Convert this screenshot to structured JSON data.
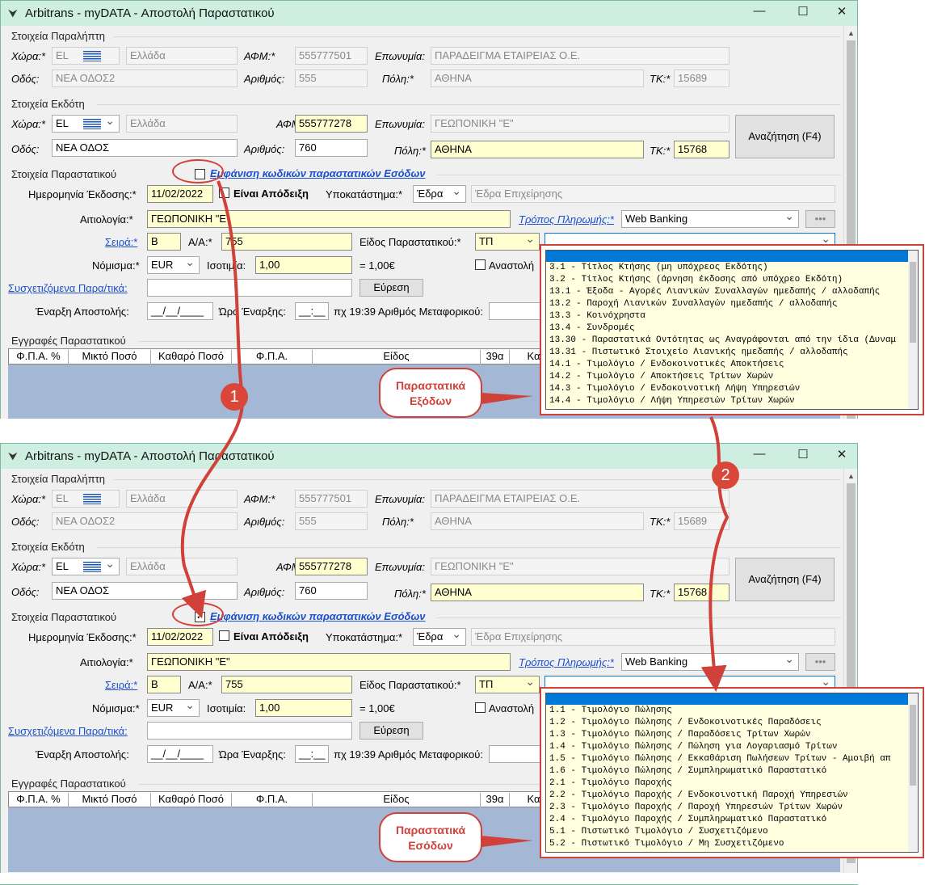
{
  "window": {
    "title": "Arbitrans - myDATA - Αποστολή Παραστατικού",
    "minimize": "—",
    "maximize": "☐",
    "close": "✕"
  },
  "recipient": {
    "section": "Στοιχεία Παραλήπτη",
    "country_label": "Χώρα:*",
    "country_code": "EL",
    "country_name": "Ελλάδα",
    "afm_label": "ΑΦΜ:*",
    "afm": "555777501",
    "name_label": "Επωνυμία:",
    "name": "ΠΑΡΑΔΕΙΓΜΑ ΕΤΑΙΡΕΙΑΣ Ο.Ε.",
    "street_label": "Οδός:",
    "street": "ΝΕΑ ΟΔΟΣ2",
    "number_label": "Αριθμός:",
    "number": "555",
    "city_label": "Πόλη:*",
    "city": "ΑΘΗΝΑ",
    "zip_label": "ΤΚ:*",
    "zip": "15689"
  },
  "issuer": {
    "section": "Στοιχεία Εκδότη",
    "country_label": "Χώρα:*",
    "country_code": "EL",
    "country_name": "Ελλάδα",
    "afm_label": "ΑΦΜ:*",
    "afm": "555777278",
    "name_label": "Επωνυμία:",
    "name": "ΓΕΩΠΟΝΙΚΗ \"Ε\"",
    "street_label": "Οδός:",
    "street": "ΝΕΑ ΟΔΟΣ",
    "number_label": "Αριθμός:",
    "number": "760",
    "city_label": "Πόλη:*",
    "city": "ΑΘΗΝΑ",
    "zip_label": "ΤΚ:*",
    "zip1": "15768",
    "zip2": "15768",
    "search_button": "Αναζήτηση (F4)"
  },
  "document": {
    "section": "Στοιχεία Παραστατικού",
    "expense_codes_link": "Εμφάνιση κωδικών παραστατικών Εσόδων",
    "check_mark": "✓",
    "date_label": "Ημερομηνία Έκδοσης:*",
    "date": "11/02/2022",
    "is_receipt": "Είναι Απόδειξη",
    "branch_label": "Υποκατάστημα:*",
    "branch": "Έδρα",
    "branch_desc": "Έδρα Επιχείρησης",
    "reason_label": "Αιτιολογία:*",
    "reason": "ΓΕΩΠΟΝΙΚΗ \"Ε\"",
    "payment_link": "Τρόπος Πληρωμής:*",
    "payment": "Web Banking",
    "more_button": "•••",
    "series_link": "Σειρά:*",
    "series": "Β",
    "aa_label": "Α/Α:*",
    "aa": "755",
    "type_label": "Είδος Παραστατικού:*",
    "type": "ΤΠ",
    "currency_label": "Νόμισμα:*",
    "currency": "EUR",
    "rate_label": "Ισοτιμία:",
    "rate": "1,00",
    "rate_eq": "= 1,00€",
    "suspend_label": "Αναστολή",
    "related_link": "Συσχετιζόμενα Παρα/τικά:",
    "find_button": "Εύρεση",
    "send_start_label": "Έναρξη Αποστολής:",
    "send_date_mask": "__/__/____",
    "time_label": "Ώρα Έναρξης:",
    "time_mask": "__:__",
    "vehicle_label": "πχ 19:39 Αριθμός Μεταφορικού:"
  },
  "entries": {
    "section": "Εγγραφές Παραστατικού",
    "columns": [
      "Φ.Π.Α. %",
      "Μικτό Ποσό",
      "Καθαρό Ποσό",
      "Φ.Π.Α.",
      "Είδος",
      "39α",
      "Κα"
    ]
  },
  "dropdown_expenses": [
    "3.1  - Τίτλος Κτήσης (μη υπόχρεος Εκδότης)",
    "3.2  - Τίτλος Κτήσης (άρνηση έκδοσης από υπόχρεο Εκδότη)",
    "13.1  - Έξοδα - Αγορές Λιανικών Συναλλαγών ημεδαπής / αλλοδαπής",
    "13.2  - Παροχή Λιανικών Συναλλαγών ημεδαπής / αλλοδαπής",
    "13.3  - Κοινόχρηστα",
    "13.4  - Συνδρομές",
    "13.30 - Παραστατικά Οντότητας ως Αναγράφονται από την ίδια (Δυναμ",
    "13.31 - Πιστωτικό Στοιχείο Λιανικής ημεδαπής / αλλοδαπής",
    "14.1  - Τιμολόγιο / Ενδοκοινοτικές Αποκτήσεις",
    "14.2  - Τιμολόγιο / Αποκτήσεις Τρίτων Χωρών",
    "14.3  - Τιμολόγιο / Ενδοκοινοτική Λήψη Υπηρεσιών",
    "14.4  - Τιμολόγιο / Λήψη Υπηρεσιών Τρίτων Χωρών"
  ],
  "dropdown_income": [
    "1.1 - Τιμολόγιο Πώλησης",
    "1.2 - Τιμολόγιο Πώλησης / Ενδοκοινοτικές Παραδόσεις",
    "1.3 - Τιμολόγιο Πώλησης / Παραδόσεις Τρίτων Χωρών",
    "1.4 - Τιμολόγιο Πώλησης / Πώληση για Λογαριασμό Τρίτων",
    "1.5 - Τιμολόγιο Πώλησης / Εκκαθάριση Πωλήσεων Τρίτων - Αμοιβή απ",
    "1.6 - Τιμολόγιο Πώλησης / Συμπληρωματικό Παραστατικό",
    "2.1 - Τιμολόγιο Παροχής",
    "2.2 - Τιμολόγιο Παροχής / Ενδοκοινοτική Παροχή Υπηρεσιών",
    "2.3 - Τιμολόγιο Παροχής / Παροχή Υπηρεσιών Τρίτων Χωρών",
    "2.4 - Τιμολόγιο Παροχής / Συμπληρωματικό Παραστατικό",
    "5.1 - Πιστωτικό Τιμολόγιο / Συσχετιζόμενο",
    "5.2 - Πιστωτικό Τιμολόγιο / Μη Συσχετιζόμενο"
  ],
  "annotations": {
    "callout_expenses": "Παραστατικά Εξόδων",
    "callout_income": "Παραστατικά Εσόδων",
    "badge1": "1",
    "badge2": "2"
  },
  "colors": {
    "accent": "#d0413a",
    "selection": "#0078d7",
    "required_field": "#ffffd0"
  }
}
